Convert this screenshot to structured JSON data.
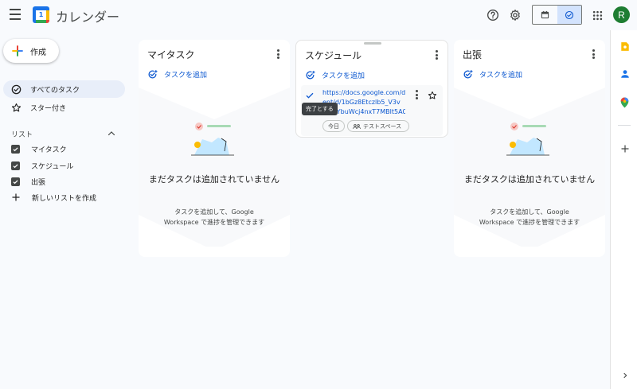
{
  "header": {
    "app_title": "カレンダー",
    "logo_day": "1",
    "avatar_initial": "R"
  },
  "sidebar": {
    "create_label": "作成",
    "nav": [
      {
        "label": "すべてのタスク",
        "active": true
      },
      {
        "label": "スター付き",
        "active": false
      }
    ],
    "lists_header": "リスト",
    "lists": [
      {
        "label": "マイタスク",
        "checked": true
      },
      {
        "label": "スケジュール",
        "checked": true
      },
      {
        "label": "出張",
        "checked": true
      }
    ],
    "new_list_label": "新しいリストを作成"
  },
  "columns": [
    {
      "title": "マイタスク",
      "add_task_label": "タスクを追加",
      "empty_title": "まだタスクは追加されていません",
      "empty_sub_1": "タスクを追加して、Google",
      "empty_sub_2": "Workspace で進捗を管理できます"
    },
    {
      "title": "スケジュール",
      "add_task_label": "タスクを追加",
      "task": {
        "link_lines": [
          "https://docs.google.com/d",
          "ent/d/1bGz8Etczlb5_V3v",
          "pOlzYbuWcj4nxT7MBlt5A0"
        ],
        "chip_date": "今日",
        "chip_space": "テストスペース",
        "tooltip": "完了とする"
      }
    },
    {
      "title": "出張",
      "add_task_label": "タスクを追加",
      "empty_title": "まだタスクは追加されていません",
      "empty_sub_1": "タスクを追加して、Google",
      "empty_sub_2": "Workspace で進捗を管理できます"
    }
  ],
  "colors": {
    "accent": "#0b57d0",
    "avatar": "#1e7d32",
    "active_nav": "#e8eef9"
  },
  "icons": {
    "menu": "hamburger-icon",
    "help": "help-icon",
    "settings": "gear-icon",
    "calendar_view": "calendar-icon",
    "tasks_view": "tasks-check-icon",
    "apps": "apps-grid-icon",
    "keep": "keep-icon",
    "contacts": "contacts-icon",
    "maps": "maps-pin-icon",
    "add": "plus-icon",
    "expand": "chevron-right-icon"
  }
}
